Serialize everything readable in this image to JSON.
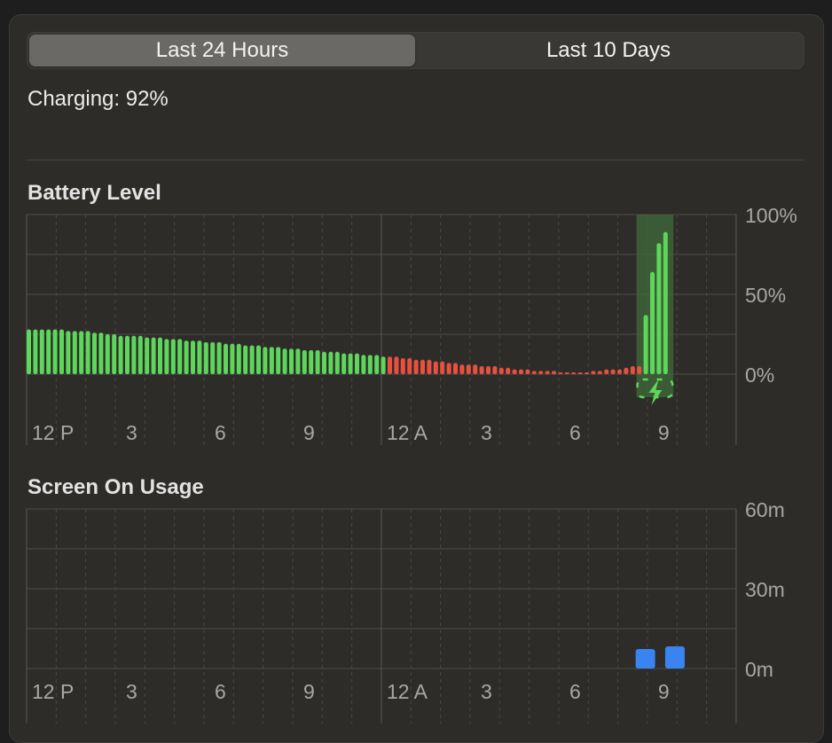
{
  "tabs": [
    {
      "label": "Last 24 Hours",
      "active": true
    },
    {
      "label": "Last 10 Days",
      "active": false
    }
  ],
  "status_text": "Charging: 92%",
  "battery": {
    "title": "Battery Level",
    "y_labels": [
      "100%",
      "50%",
      "0%"
    ],
    "x_labels": [
      "12 P",
      "3",
      "6",
      "9",
      "12 A",
      "3",
      "6",
      "9"
    ],
    "charging_icon": "bolt-icon",
    "colors": {
      "normal": "#5dd65b",
      "low": "#e8503f",
      "charging_band": "#3f6b3a"
    }
  },
  "screen": {
    "title": "Screen On Usage",
    "y_labels": [
      "60m",
      "30m",
      "0m"
    ],
    "x_labels": [
      "12 P",
      "3",
      "6",
      "9",
      "12 A",
      "3",
      "6",
      "9"
    ],
    "colors": {
      "bar": "#3a84f2"
    }
  },
  "chart_data": [
    {
      "type": "bar",
      "title": "Battery Level",
      "ylim": [
        0,
        100
      ],
      "unit": "%",
      "categories": [
        "12 P",
        "3",
        "6",
        "9",
        "12 A",
        "3",
        "6",
        "9"
      ],
      "values": [
        28,
        28,
        28,
        28,
        28,
        28,
        27,
        27,
        27,
        27,
        26,
        26,
        25,
        25,
        24,
        24,
        24,
        24,
        23,
        23,
        23,
        22,
        22,
        22,
        21,
        21,
        21,
        20,
        20,
        20,
        19,
        19,
        19,
        18,
        18,
        18,
        17,
        17,
        17,
        16,
        16,
        16,
        15,
        15,
        15,
        14,
        14,
        14,
        13,
        13,
        13,
        12,
        12,
        12,
        11,
        11,
        11,
        10,
        10,
        9,
        9,
        9,
        8,
        8,
        7,
        7,
        6,
        6,
        6,
        5,
        5,
        5,
        4,
        4,
        3,
        3,
        3,
        2,
        2,
        2,
        2,
        1,
        1,
        1,
        1,
        1,
        2,
        2,
        3,
        3,
        3,
        4,
        5,
        5,
        37,
        64,
        82,
        89
      ],
      "low_range": [
        55,
        93
      ],
      "charging_range": [
        94,
        97
      ]
    },
    {
      "type": "bar",
      "title": "Screen On Usage",
      "ylim": [
        0,
        60
      ],
      "unit": "m",
      "categories": [
        "12 P",
        "3",
        "6",
        "9",
        "12 A",
        "3",
        "6",
        "9"
      ],
      "bars": [
        {
          "hour": 20.6,
          "value": 9
        },
        {
          "hour": 21.6,
          "value": 10
        }
      ]
    }
  ]
}
